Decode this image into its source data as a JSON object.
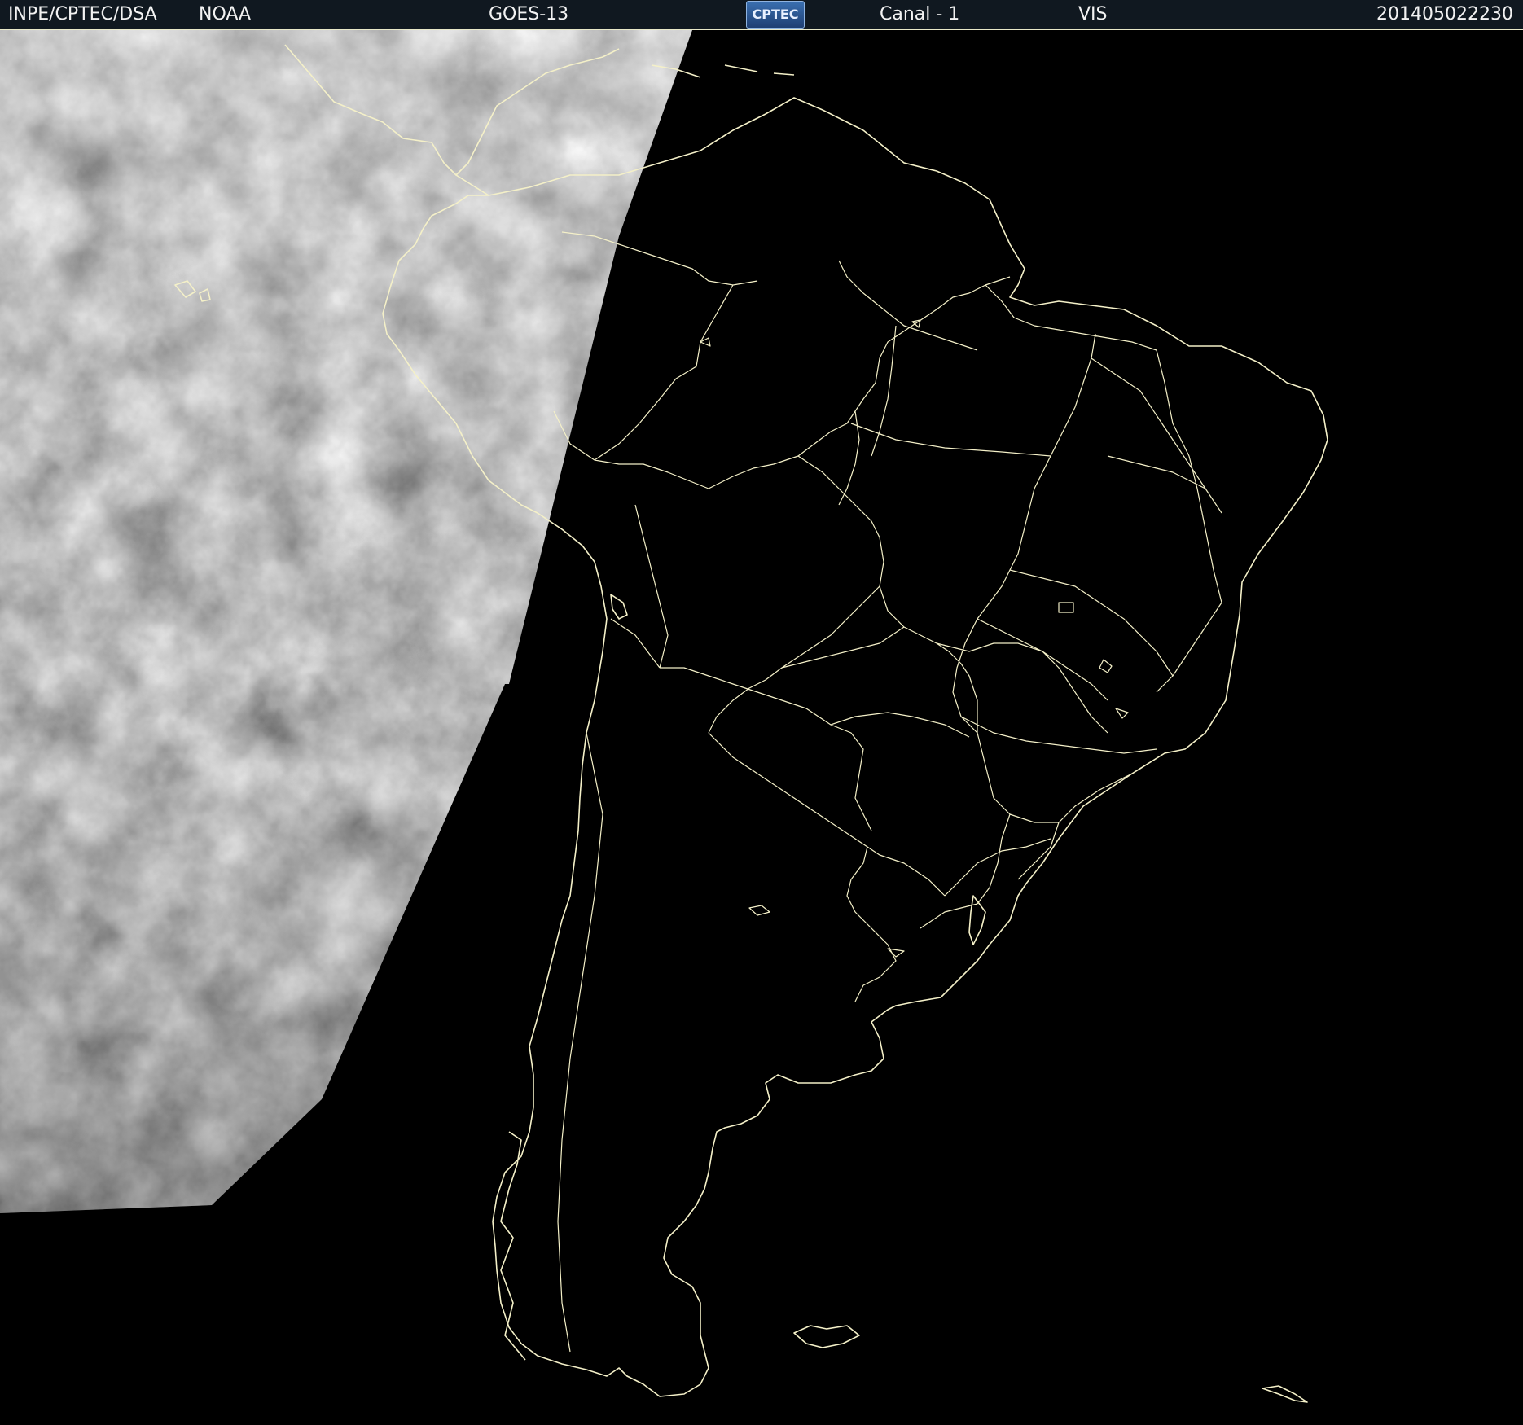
{
  "header": {
    "institution": "INPE/CPTEC/DSA",
    "agency": "NOAA",
    "satellite": "GOES-13",
    "logo_text": "CPTEC",
    "channel": "Canal - 1",
    "band": "VIS",
    "timestamp": "201405022230"
  },
  "map": {
    "coastline_color": "#f4f0c8",
    "ocean_color": "#000000",
    "cloud_color": "#8a8a8a"
  }
}
